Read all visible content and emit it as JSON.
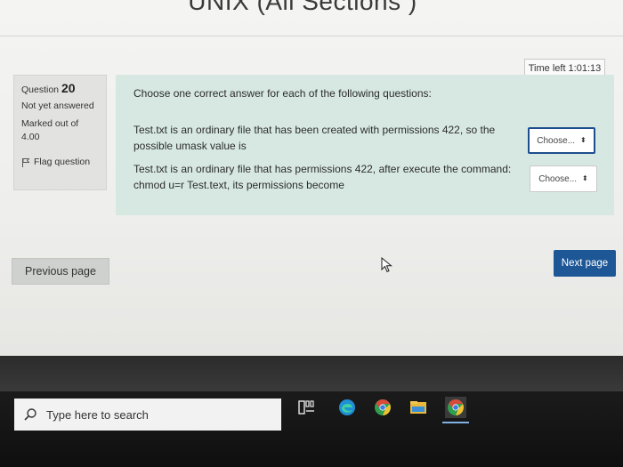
{
  "page": {
    "title": "UNIX (All Sections )"
  },
  "timer": {
    "label": "Time left 1:01:13"
  },
  "question_info": {
    "question_label": "Question",
    "question_number": "20",
    "state": "Not yet answered",
    "marks": "Marked out of 4.00",
    "flag_label": "Flag question"
  },
  "content": {
    "intro": "Choose one correct answer for each of the following questions:",
    "subquestions": [
      {
        "text": "Test.txt is an ordinary file that has been created with permissions 422, so the possible umask value is",
        "select_value": "Choose..."
      },
      {
        "text": "Test.txt is an ordinary file that has permissions 422, after execute the command: chmod u=r Test.text, its permissions become",
        "select_value": "Choose..."
      }
    ]
  },
  "nav": {
    "previous_label": "Previous page",
    "next_label": "Next page"
  },
  "taskbar": {
    "search_placeholder": "Type here to search",
    "icons": [
      "task-view-icon",
      "edge-icon",
      "chrome-icon",
      "file-explorer-icon",
      "chrome-active-icon"
    ]
  },
  "colors": {
    "content_bg": "#d7e8e3",
    "next_button": "#1e5796",
    "taskbar": "#111111"
  }
}
